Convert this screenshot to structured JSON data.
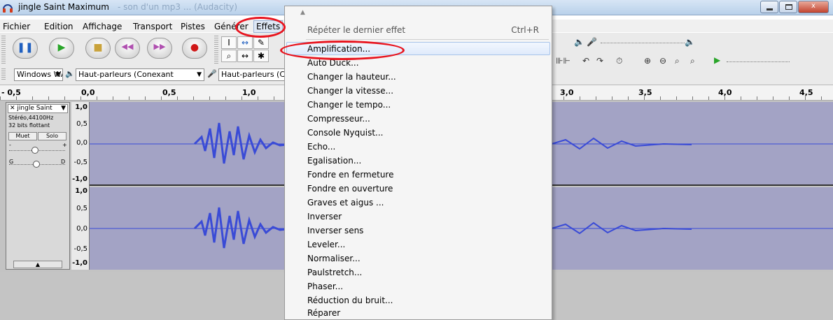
{
  "window": {
    "title": "jingle Saint Maximum",
    "title_faded": "- son d'un mp3 ... (Audacity)",
    "controls": {
      "minimize": "",
      "maximize": "",
      "close": "x"
    }
  },
  "menubar": {
    "items": [
      "Fichier",
      "Edition",
      "Affichage",
      "Transport",
      "Pistes",
      "Générer",
      "Effets"
    ],
    "active": "Effets"
  },
  "transport": {
    "buttons": [
      "pause",
      "play",
      "stop",
      "skip-start",
      "skip-end",
      "record"
    ]
  },
  "tools": {
    "cells": [
      "I",
      "↔",
      "✎",
      "⌕",
      "↔",
      "✱"
    ]
  },
  "devices": {
    "host": "Windows WA:",
    "output": "Haut-parleurs (Conexant",
    "input": "Haut-parleurs (Co"
  },
  "ruler": {
    "ticks_left": [
      "- 0,5",
      "0,0",
      "0,5",
      "1,0"
    ],
    "ticks_right": [
      "3,0",
      "3,5",
      "4,0",
      "4,5"
    ]
  },
  "track": {
    "name": "jingle Saint",
    "format_line": "Stéréo,44100Hz",
    "bits_line": "32 bits flottant",
    "mute": "Muet",
    "solo": "Solo",
    "gain_minus": "-",
    "gain_plus": "+",
    "pan_left": "G",
    "pan_right": "D",
    "scale_ch1": [
      "1,0",
      "0,5",
      "0,0",
      "-0,5",
      "-1,0"
    ],
    "scale_ch2": [
      "1,0",
      "0,5",
      "0,0",
      "-0,5",
      "-1,0"
    ]
  },
  "effects_menu": {
    "repeat_label": "Répéter le dernier effet",
    "repeat_shortcut": "Ctrl+R",
    "items": [
      "Amplification...",
      "Auto Duck...",
      "Changer la hauteur...",
      "Changer la vitesse...",
      "Changer le tempo...",
      "Compresseur...",
      "Console Nyquist...",
      "Echo...",
      "Egalisation...",
      "Fondre en fermeture",
      "Fondre en ouverture",
      "Graves et aigus ...",
      "Inverser",
      "Inverser sens",
      "Leveler...",
      "Normaliser...",
      "Paulstretch...",
      "Phaser...",
      "Réduction du bruit...",
      "Réparer"
    ],
    "highlighted": "Amplification..."
  },
  "colors": {
    "annotation_red": "#e8141e",
    "wave_bg": "#a3a3c5",
    "wave_fg": "#3a4bd6",
    "menu_highlight": "#dfeafb"
  }
}
